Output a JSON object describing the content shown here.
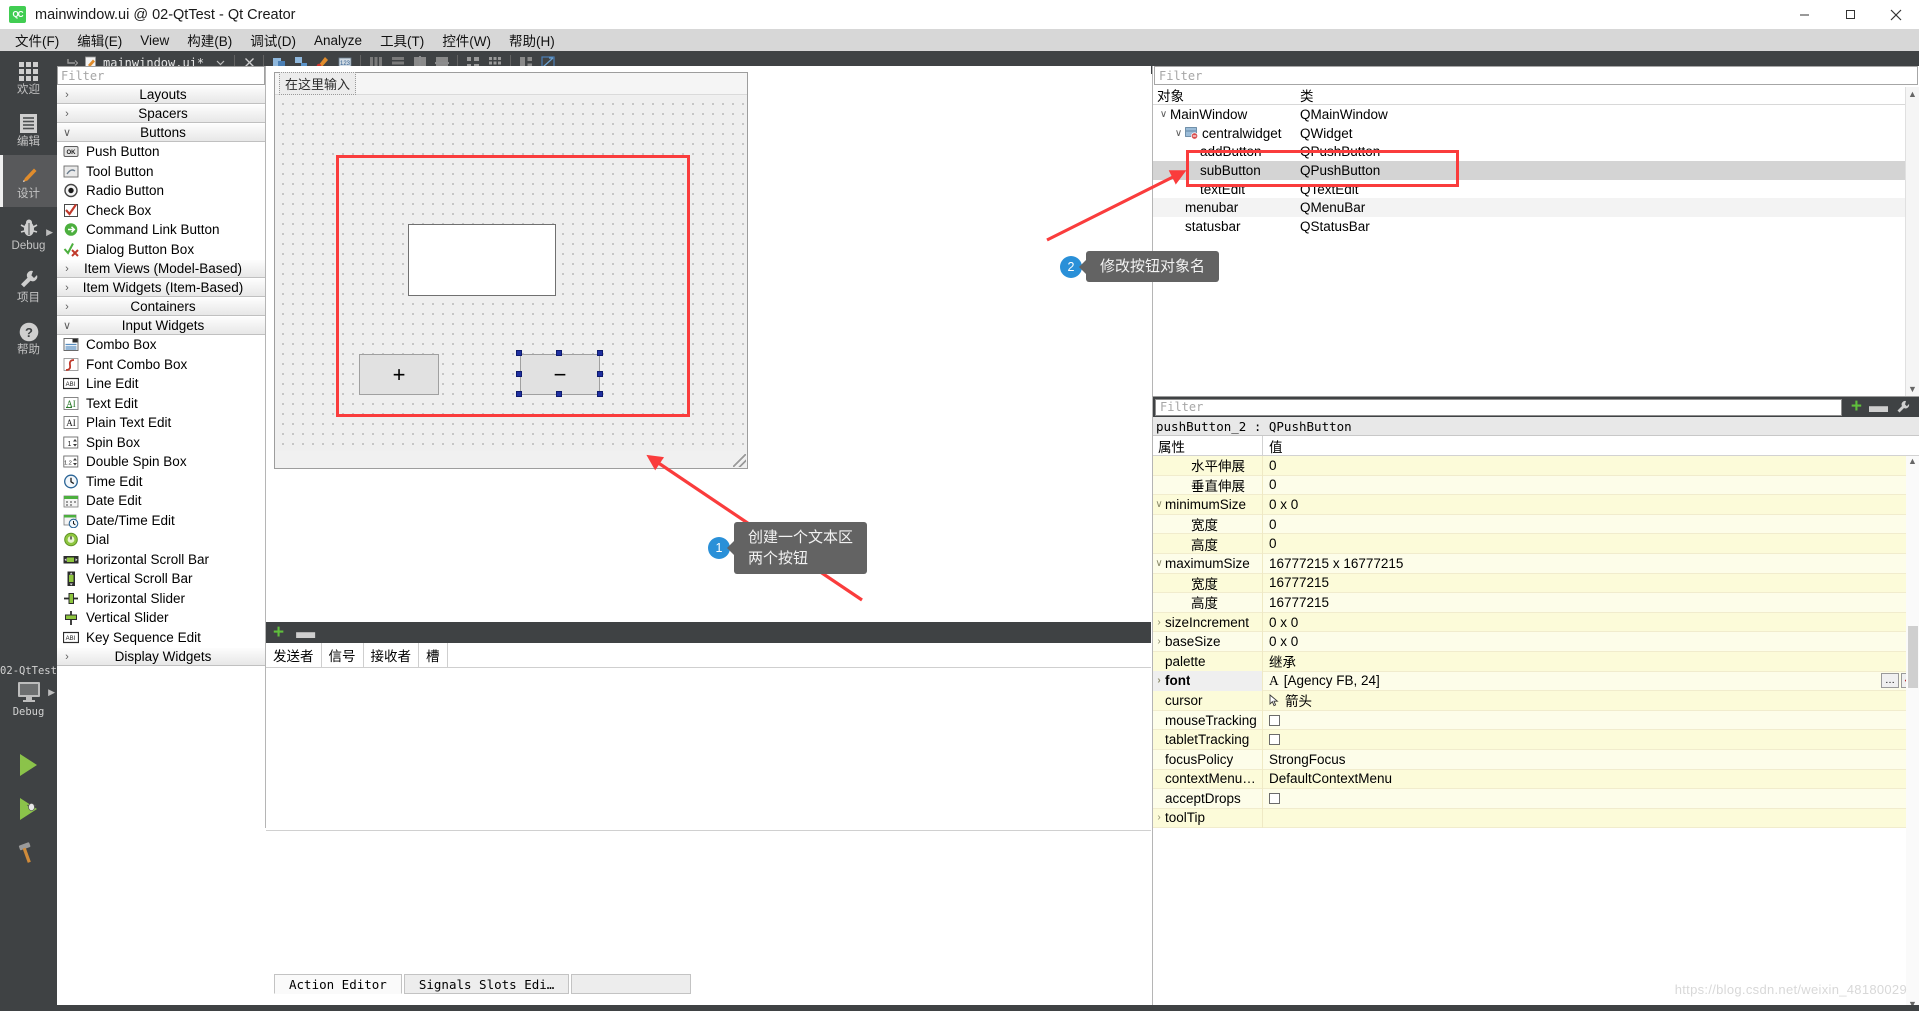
{
  "window": {
    "title": "mainwindow.ui @ 02-QtTest - Qt Creator",
    "logo_text": "QC",
    "minimize": "—",
    "maximize": "❐",
    "close": "✕"
  },
  "menubar": {
    "items": [
      "文件(F)",
      "编辑(E)",
      "View",
      "构建(B)",
      "调试(D)",
      "Analyze",
      "工具(T)",
      "控件(W)",
      "帮助(H)"
    ]
  },
  "modebar": {
    "items": [
      {
        "label": "欢迎",
        "icon": "grid-icon",
        "active": false,
        "arrow": false
      },
      {
        "label": "编辑",
        "icon": "document-icon",
        "active": false,
        "arrow": false
      },
      {
        "label": "设计",
        "icon": "pencil-icon",
        "active": true,
        "arrow": false
      },
      {
        "label": "Debug",
        "icon": "bug-icon",
        "active": false,
        "arrow": true
      },
      {
        "label": "项目",
        "icon": "wrench-icon",
        "active": false,
        "arrow": false
      },
      {
        "label": "帮助",
        "icon": "question-icon",
        "active": false,
        "arrow": false
      }
    ],
    "kit_name": "02-QtTest",
    "kit_mode": "Debug",
    "kit_icon": "monitor-icon",
    "run_icon": "run-triangle-icon",
    "debug_icon": "debug-triangle-icon",
    "build_icon": "hammer-icon"
  },
  "filebar": {
    "file_name": "mainwindow.ui*",
    "back_icon": "navigate-back-icon",
    "doc_icon": "ui-file-icon",
    "dropdown_icon": "chevron-down-icon",
    "close_icon": "close-document-icon",
    "tools": [
      "edit-widgets-icon",
      "edit-signals-slots-icon",
      "edit-buddies-icon",
      "edit-tab-order-icon",
      "layout-horizontal-icon",
      "layout-vertical-icon",
      "layout-splitter-h-icon",
      "layout-splitter-v-icon",
      "layout-form-icon",
      "layout-grid-icon",
      "break-layout-icon",
      "adjust-size-icon"
    ]
  },
  "widgetbox": {
    "filter_placeholder": "Filter",
    "groups": [
      {
        "title": "Layouts",
        "expanded": false,
        "items": []
      },
      {
        "title": "Spacers",
        "expanded": false,
        "items": []
      },
      {
        "title": "Buttons",
        "expanded": true,
        "items": [
          {
            "label": "Push Button",
            "icon": "push-button-icon"
          },
          {
            "label": "Tool Button",
            "icon": "tool-button-icon"
          },
          {
            "label": "Radio Button",
            "icon": "radio-button-icon"
          },
          {
            "label": "Check Box",
            "icon": "check-box-icon"
          },
          {
            "label": "Command Link Button",
            "icon": "command-link-button-icon"
          },
          {
            "label": "Dialog Button Box",
            "icon": "dialog-button-box-icon"
          }
        ]
      },
      {
        "title": "Item Views (Model-Based)",
        "expanded": false,
        "items": []
      },
      {
        "title": "Item Widgets (Item-Based)",
        "expanded": false,
        "items": []
      },
      {
        "title": "Containers",
        "expanded": false,
        "items": []
      },
      {
        "title": "Input Widgets",
        "expanded": true,
        "items": [
          {
            "label": "Combo Box",
            "icon": "combo-box-icon"
          },
          {
            "label": "Font Combo Box",
            "icon": "font-combo-box-icon"
          },
          {
            "label": "Line Edit",
            "icon": "line-edit-icon"
          },
          {
            "label": "Text Edit",
            "icon": "text-edit-icon"
          },
          {
            "label": "Plain Text Edit",
            "icon": "plain-text-edit-icon"
          },
          {
            "label": "Spin Box",
            "icon": "spin-box-icon"
          },
          {
            "label": "Double Spin Box",
            "icon": "double-spin-box-icon"
          },
          {
            "label": "Time Edit",
            "icon": "time-edit-icon"
          },
          {
            "label": "Date Edit",
            "icon": "date-edit-icon"
          },
          {
            "label": "Date/Time Edit",
            "icon": "date-time-edit-icon"
          },
          {
            "label": "Dial",
            "icon": "dial-icon"
          },
          {
            "label": "Horizontal Scroll Bar",
            "icon": "h-scroll-bar-icon"
          },
          {
            "label": "Vertical Scroll Bar",
            "icon": "v-scroll-bar-icon"
          },
          {
            "label": "Horizontal Slider",
            "icon": "h-slider-icon"
          },
          {
            "label": "Vertical Slider",
            "icon": "v-slider-icon"
          },
          {
            "label": "Key Sequence Edit",
            "icon": "key-sequence-edit-icon"
          }
        ]
      },
      {
        "title": "Display Widgets",
        "expanded": false,
        "items": []
      }
    ]
  },
  "form": {
    "menu_hint": "在这里输入",
    "add_button_text": "+",
    "sub_button_text": "−",
    "selected_widget": "sub"
  },
  "signals_pane": {
    "add_icon": "plus-icon",
    "remove_icon": "minus-icon",
    "columns": [
      "发送者",
      "信号",
      "接收者",
      "槽"
    ],
    "rows": [],
    "tabs": [
      {
        "label": "Action Editor",
        "active": true
      },
      {
        "label": "Signals  Slots Edi…",
        "active": false
      }
    ]
  },
  "object_inspector": {
    "filter_placeholder": "Filter",
    "columns": [
      "对象",
      "类"
    ],
    "rows": [
      {
        "name": "MainWindow",
        "class": "QMainWindow",
        "indent": 0,
        "twisty": "expanded",
        "icon": "",
        "selected": false,
        "highlight": false
      },
      {
        "name": "centralwidget",
        "class": "QWidget",
        "indent": 1,
        "twisty": "expanded",
        "icon": "central-widget-icon",
        "selected": false,
        "highlight": false
      },
      {
        "name": "addButton",
        "class": "QPushButton",
        "indent": 2,
        "twisty": "",
        "icon": "",
        "selected": false,
        "highlight": false
      },
      {
        "name": "subButton",
        "class": "QPushButton",
        "indent": 2,
        "twisty": "",
        "icon": "",
        "selected": true,
        "highlight": false
      },
      {
        "name": "textEdit",
        "class": "QTextEdit",
        "indent": 2,
        "twisty": "",
        "icon": "",
        "selected": false,
        "highlight": false
      },
      {
        "name": "menubar",
        "class": "QMenuBar",
        "indent": 1,
        "twisty": "",
        "icon": "",
        "selected": false,
        "highlight": true
      },
      {
        "name": "statusbar",
        "class": "QStatusBar",
        "indent": 1,
        "twisty": "",
        "icon": "",
        "selected": false,
        "highlight": false
      }
    ],
    "scroll_up_icon": "chevron-up-icon",
    "scroll_down_icon": "chevron-down-icon"
  },
  "property_editor": {
    "filter_placeholder": "Filter",
    "add_icon": "plus-icon",
    "remove_icon": "minus-icon",
    "config_icon": "wrench-icon",
    "object_line": "pushButton_2 : QPushButton",
    "columns": [
      "属性",
      "值"
    ],
    "rows": [
      {
        "name": "水平伸展",
        "value": "0",
        "indent": 1,
        "twisty": "",
        "bold": false,
        "type": "text"
      },
      {
        "name": "垂直伸展",
        "value": "0",
        "indent": 1,
        "twisty": "",
        "bold": false,
        "type": "text"
      },
      {
        "name": "minimumSize",
        "value": "0 x 0",
        "indent": 0,
        "twisty": "expanded",
        "bold": false,
        "type": "text"
      },
      {
        "name": "宽度",
        "value": "0",
        "indent": 1,
        "twisty": "",
        "bold": false,
        "type": "text"
      },
      {
        "name": "高度",
        "value": "0",
        "indent": 1,
        "twisty": "",
        "bold": false,
        "type": "text"
      },
      {
        "name": "maximumSize",
        "value": "16777215 x 16777215",
        "indent": 0,
        "twisty": "expanded",
        "bold": false,
        "type": "text"
      },
      {
        "name": "宽度",
        "value": "16777215",
        "indent": 1,
        "twisty": "",
        "bold": false,
        "type": "text"
      },
      {
        "name": "高度",
        "value": "16777215",
        "indent": 1,
        "twisty": "",
        "bold": false,
        "type": "text"
      },
      {
        "name": "sizeIncrement",
        "value": "0 x 0",
        "indent": 0,
        "twisty": "collapsed",
        "bold": false,
        "type": "text"
      },
      {
        "name": "baseSize",
        "value": "0 x 0",
        "indent": 0,
        "twisty": "collapsed",
        "bold": false,
        "type": "text"
      },
      {
        "name": "palette",
        "value": "继承",
        "indent": 0,
        "twisty": "",
        "bold": false,
        "type": "text"
      },
      {
        "name": "font",
        "value": "[Agency FB, 24]",
        "indent": 0,
        "twisty": "collapsed",
        "bold": true,
        "type": "font"
      },
      {
        "name": "cursor",
        "value": "箭头",
        "indent": 0,
        "twisty": "",
        "bold": false,
        "type": "cursor"
      },
      {
        "name": "mouseTracking",
        "value": "",
        "indent": 0,
        "twisty": "",
        "bold": false,
        "type": "checkbox"
      },
      {
        "name": "tabletTracking",
        "value": "",
        "indent": 0,
        "twisty": "",
        "bold": false,
        "type": "checkbox"
      },
      {
        "name": "focusPolicy",
        "value": "StrongFocus",
        "indent": 0,
        "twisty": "",
        "bold": false,
        "type": "text"
      },
      {
        "name": "contextMenu…",
        "value": "DefaultContextMenu",
        "indent": 0,
        "twisty": "",
        "bold": false,
        "type": "text"
      },
      {
        "name": "acceptDrops",
        "value": "",
        "indent": 0,
        "twisty": "",
        "bold": false,
        "type": "checkbox"
      },
      {
        "name": "toolTip",
        "value": "",
        "indent": 0,
        "twisty": "collapsed",
        "bold": false,
        "type": "text"
      }
    ]
  },
  "annotations": [
    {
      "number": "1",
      "text": "创建一个文本区\n两个按钮"
    },
    {
      "number": "2",
      "text": "修改按钮对象名"
    }
  ],
  "watermark": "https://blog.csdn.net/weixin_48180029",
  "colors": {
    "accent_red": "#fa3c3c",
    "callout_bg": "#636363",
    "callout_num": "#2a90d8",
    "dark_chrome": "#3f4244",
    "property_yellow": "#fcfbd9",
    "qt_green": "#41cd52"
  }
}
